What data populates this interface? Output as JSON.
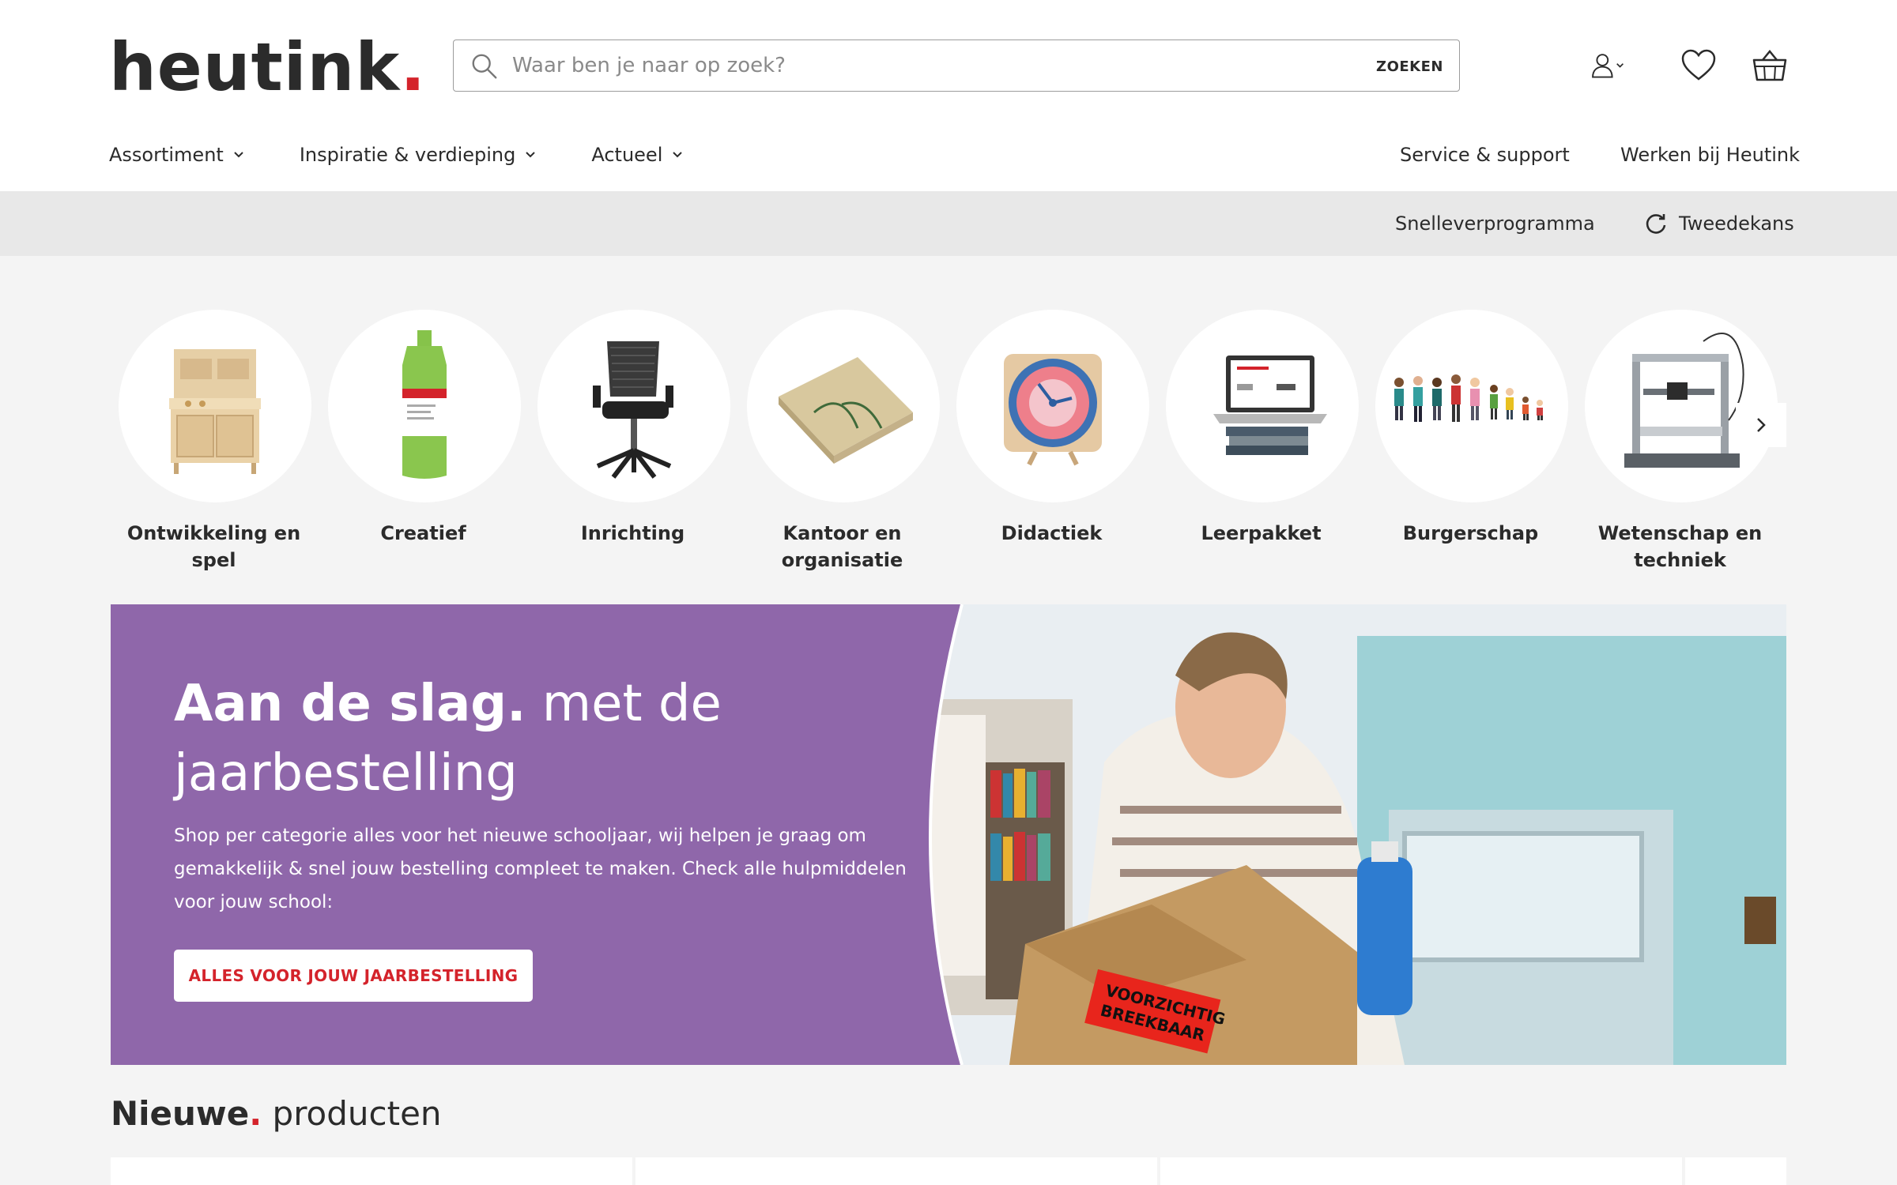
{
  "header": {
    "logo_text": "heutink",
    "logo_dot": ".",
    "search": {
      "placeholder": "Waar ben je naar op zoek?",
      "button_label": "ZOEKEN"
    },
    "icons": [
      "account-icon",
      "heart-icon",
      "basket-icon"
    ]
  },
  "nav": {
    "items": [
      {
        "label": "Assortiment"
      },
      {
        "label": "Inspiratie & verdieping"
      },
      {
        "label": "Actueel"
      }
    ],
    "right": [
      {
        "label": "Service & support"
      },
      {
        "label": "Werken bij Heutink"
      }
    ]
  },
  "subbar": {
    "items": [
      {
        "label": "Snelleverprogramma"
      },
      {
        "label": "Tweedekans"
      }
    ]
  },
  "categories": [
    {
      "label": "Ontwikkeling en spel"
    },
    {
      "label": "Creatief"
    },
    {
      "label": "Inrichting"
    },
    {
      "label": "Kantoor en organisatie"
    },
    {
      "label": "Didactiek"
    },
    {
      "label": "Leerpakket"
    },
    {
      "label": "Burgerschap"
    },
    {
      "label": "Wetenschap en techniek"
    }
  ],
  "banner": {
    "title_strong": "Aan de slag.",
    "title_rest": " met de jaarbestelling",
    "text": "Shop per categorie alles voor het nieuwe schooljaar, wij helpen je graag om gemakkelijk & snel jouw bestelling compleet te maken. Check alle hulpmiddelen voor jouw school:",
    "button_label": "ALLES VOOR JOUW JAARBESTELLING",
    "box_label": "VOORZICHTIG BREEKBAAR"
  },
  "section": {
    "title_strong": "Nieuwe",
    "title_dot": ".",
    "title_rest": " producten"
  },
  "colors": {
    "brand_red": "#d4232b",
    "banner_purple": "#8f67aa",
    "text": "#2b2b2b",
    "background": "#f4f4f4"
  }
}
